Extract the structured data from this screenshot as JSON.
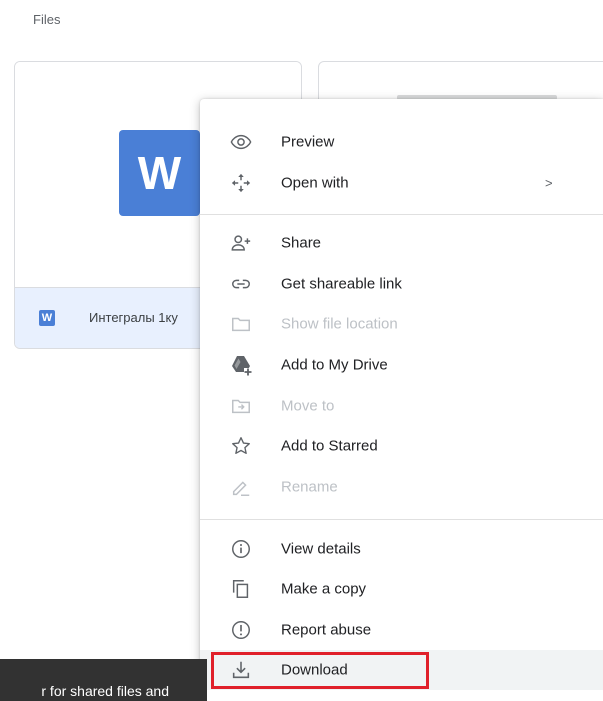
{
  "section": {
    "title": "Files"
  },
  "files": [
    {
      "name": "Интегралы 1ку",
      "type_badge": "W",
      "thumb_letter": "W"
    },
    {
      "name": ""
    }
  ],
  "context_menu": {
    "items": [
      {
        "label": "Preview",
        "icon": "eye-icon",
        "enabled": true
      },
      {
        "label": "Open with",
        "icon": "open-with-icon",
        "enabled": true,
        "submenu_arrow": ">"
      },
      {
        "label": "Share",
        "icon": "person-add-icon",
        "enabled": true
      },
      {
        "label": "Get shareable link",
        "icon": "link-icon",
        "enabled": true
      },
      {
        "label": "Show file location",
        "icon": "folder-icon",
        "enabled": false
      },
      {
        "label": "Add to My Drive",
        "icon": "drive-add-icon",
        "enabled": true
      },
      {
        "label": "Move to",
        "icon": "move-to-folder-icon",
        "enabled": false
      },
      {
        "label": "Add to Starred",
        "icon": "star-icon",
        "enabled": true
      },
      {
        "label": "Rename",
        "icon": "pencil-icon",
        "enabled": false
      },
      {
        "label": "View details",
        "icon": "info-icon",
        "enabled": true
      },
      {
        "label": "Make a copy",
        "icon": "copy-icon",
        "enabled": true
      },
      {
        "label": "Report abuse",
        "icon": "report-icon",
        "enabled": true
      },
      {
        "label": "Download",
        "icon": "download-icon",
        "enabled": true,
        "highlighted": true
      }
    ]
  },
  "snackbar": {
    "text": "r for shared files and"
  },
  "colors": {
    "word_blue": "#4a7fd6",
    "highlight_red": "#e0202a",
    "selected_card_bg": "#e8f0fe"
  }
}
